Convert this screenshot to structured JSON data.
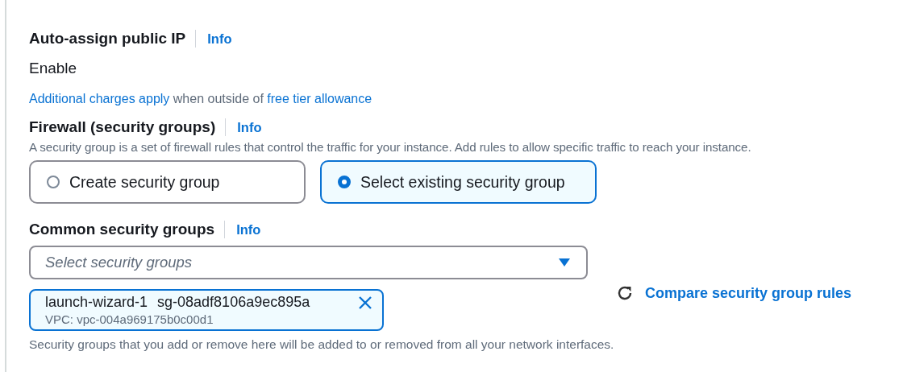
{
  "public_ip": {
    "label": "Auto-assign public IP",
    "info": "Info",
    "value": "Enable",
    "note": [
      {
        "text": "Additional charges apply",
        "link": true
      },
      {
        "text": " when outside of ",
        "link": false
      },
      {
        "text": "free tier allowance",
        "link": true
      }
    ]
  },
  "firewall": {
    "label": "Firewall (security groups)",
    "info": "Info",
    "description": "A security group is a set of firewall rules that control the traffic for your instance. Add rules to allow specific traffic to reach your instance.",
    "options": [
      {
        "label": "Create security group",
        "selected": false
      },
      {
        "label": "Select existing security group",
        "selected": true
      }
    ]
  },
  "common_groups": {
    "label": "Common security groups",
    "info": "Info",
    "select": {
      "placeholder": "Select security groups"
    },
    "chips": [
      {
        "name": "launch-wizard-1",
        "id": "sg-08adf8106a9ec895a",
        "vpc": "VPC: vpc-004a969175b0c00d1"
      }
    ],
    "compare_link": "Compare security group rules",
    "help": "Security groups that you add or remove here will be added to or removed from all your network interfaces."
  }
}
